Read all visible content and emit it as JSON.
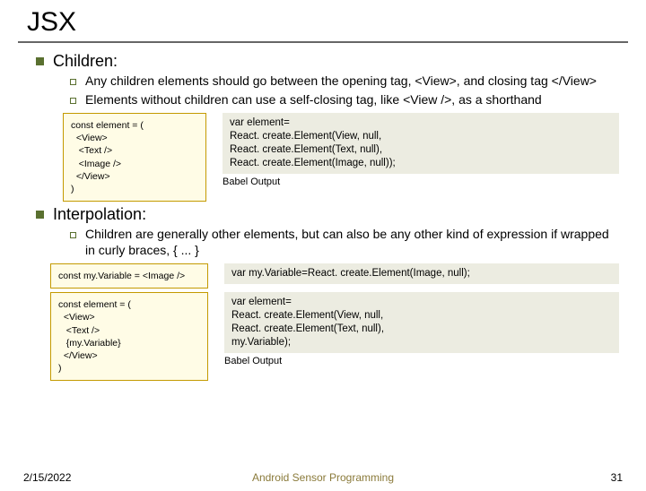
{
  "title": "JSX",
  "section1": {
    "heading": "Children:",
    "points": [
      "Any children elements should go between the opening tag, <View>, and closing tag </View>",
      "Elements without children can use a self-closing tag, like <View />, as a shorthand"
    ],
    "code_left": "const element = (\n  <View>\n   <Text />\n   <Image />\n  </View>\n)",
    "code_right": "var element=\nReact. create.Element(View, null,\nReact. create.Element(Text, null),\nReact. create.Element(Image, null));",
    "babel": "Babel Output"
  },
  "section2": {
    "heading": "Interpolation:",
    "points": [
      "Children are generally other elements, but can also be any other kind of expression if wrapped in curly braces, { ... }"
    ],
    "code_left_a": "const my.Variable = <Image />",
    "code_right_a": "var my.Variable=React. create.Element(Image, null);",
    "code_left_b": "const element = (\n  <View>\n   <Text />\n   {my.Variable}\n  </View>\n)",
    "code_right_b": "var element=\nReact. create.Element(View, null,\nReact. create.Element(Text, null),\nmy.Variable);",
    "babel": "Babel Output"
  },
  "footer": {
    "date": "2/15/2022",
    "center": "Android Sensor Programming",
    "page": "31"
  }
}
